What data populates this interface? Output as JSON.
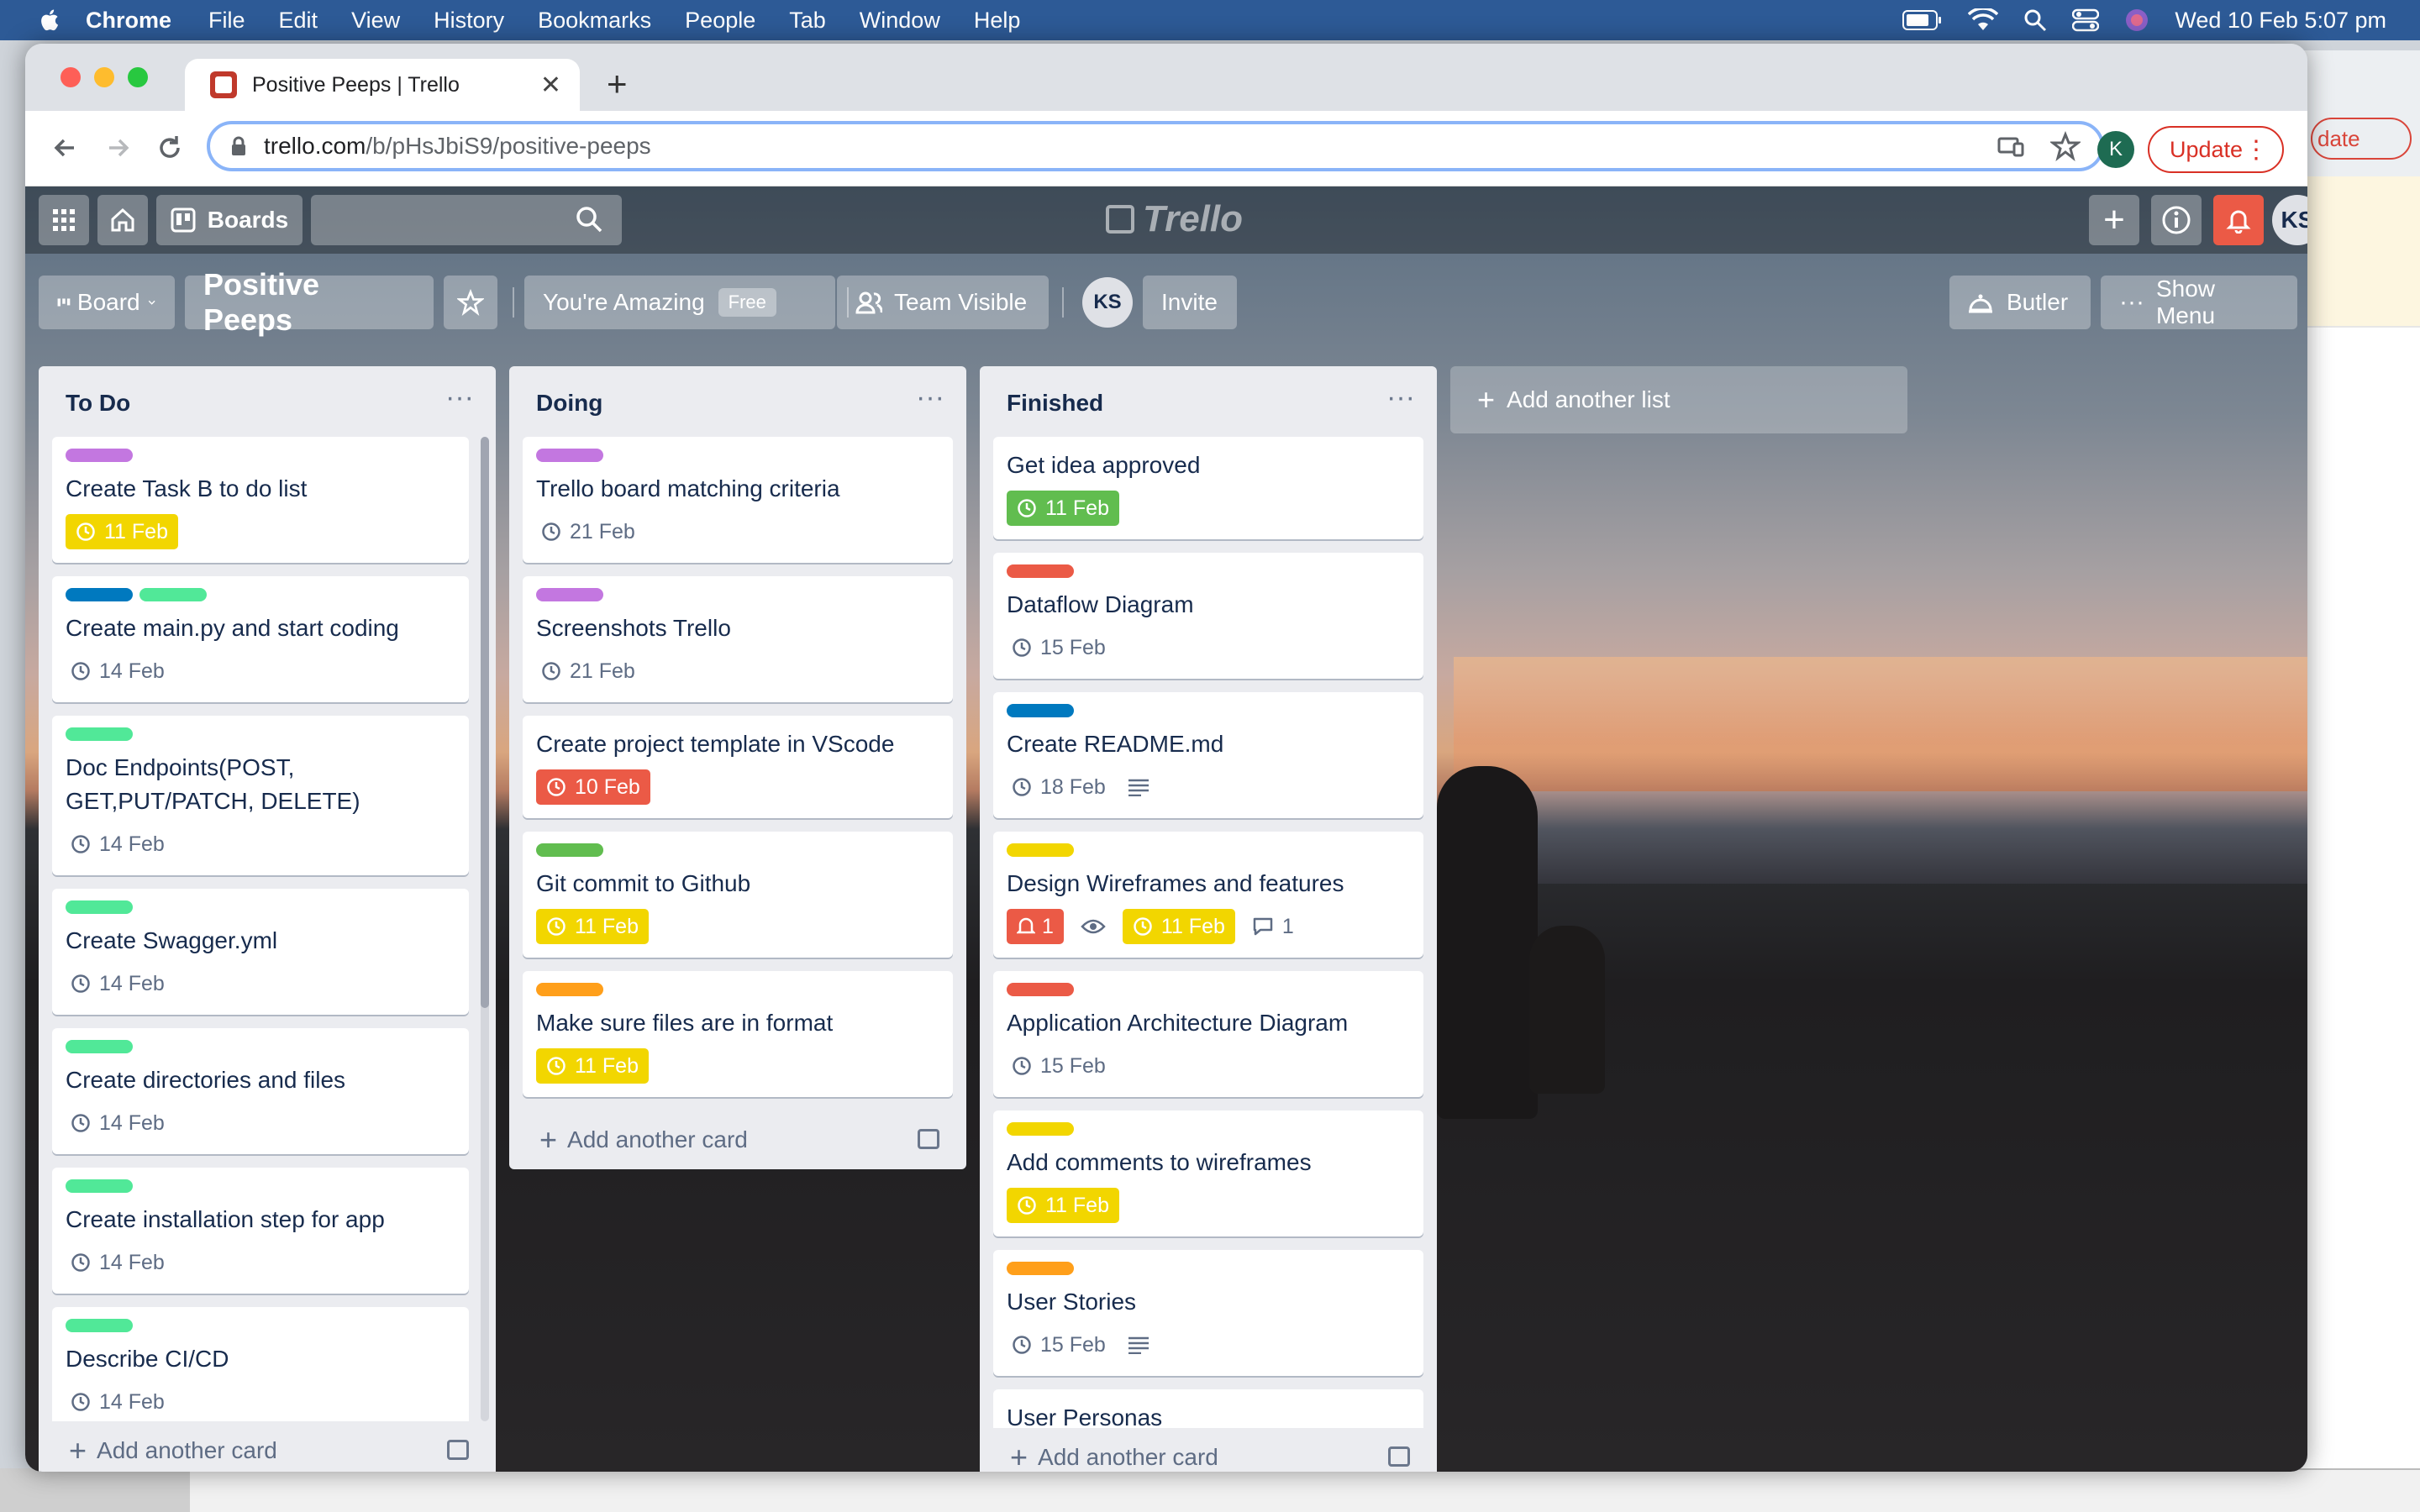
{
  "menubar": {
    "app": "Chrome",
    "items": [
      "File",
      "Edit",
      "View",
      "History",
      "Bookmarks",
      "People",
      "Tab",
      "Window",
      "Help"
    ],
    "datetime": "Wed 10 Feb  5:07 pm"
  },
  "browser": {
    "tab_title": "Positive Peeps | Trello",
    "url_host": "trello.com",
    "url_path": "/b/pHsJbiS9/positive-peeps",
    "profile_initial": "K",
    "update_label": "Update",
    "bg_update_fragment": "date"
  },
  "trello_nav": {
    "boards_label": "Boards",
    "logo_text": "Trello",
    "avatar_initials": "KS"
  },
  "board_header": {
    "view_label": "Board",
    "board_title": "Positive Peeps",
    "team_name": "You're Amazing",
    "team_badge": "Free",
    "visibility_label": "Team Visible",
    "member_initials": "KS",
    "invite_label": "Invite",
    "butler_label": "Butler",
    "show_menu_label": "Show Menu"
  },
  "lists": {
    "todo": {
      "title": "To Do",
      "add_card": "Add another card",
      "cards": [
        {
          "title": "Create Task B to do list",
          "due": "11 Feb"
        },
        {
          "title": "Create main.py and start coding",
          "due": "14 Feb"
        },
        {
          "title": "Doc Endpoints(POST, GET,PUT/PATCH, DELETE)",
          "due": "14 Feb"
        },
        {
          "title": "Create Swagger.yml",
          "due": "14 Feb"
        },
        {
          "title": "Create directories and files",
          "due": "14 Feb"
        },
        {
          "title": "Create installation step for app",
          "due": "14 Feb"
        },
        {
          "title": "Describe CI/CD",
          "due": "14 Feb"
        }
      ]
    },
    "doing": {
      "title": "Doing",
      "add_card": "Add another card",
      "cards": [
        {
          "title": "Trello board matching criteria",
          "due": "21 Feb"
        },
        {
          "title": "Screenshots Trello",
          "due": "21 Feb"
        },
        {
          "title": "Create project template in VScode",
          "due": "10 Feb"
        },
        {
          "title": "Git commit to Github",
          "due": "11 Feb"
        },
        {
          "title": "Make sure files are in format",
          "due": "11 Feb"
        }
      ]
    },
    "finished": {
      "title": "Finished",
      "add_card": "Add another card",
      "cards": [
        {
          "title": "Get idea approved",
          "due": "11 Feb"
        },
        {
          "title": "Dataflow Diagram",
          "due": "15 Feb"
        },
        {
          "title": "Create README.md",
          "due": "18 Feb"
        },
        {
          "title": "Design Wireframes and features",
          "due": "11 Feb",
          "notifications": "1",
          "comments": "1"
        },
        {
          "title": "Application Architecture Diagram",
          "due": "15 Feb"
        },
        {
          "title": "Add comments to wireframes",
          "due": "11 Feb"
        },
        {
          "title": "User Stories",
          "due": "15 Feb"
        },
        {
          "title": "User Personas"
        }
      ]
    },
    "add_list": "Add another list"
  },
  "colors": {
    "label_purple": "#c377e0",
    "label_blue": "#0079bf",
    "label_green": "#51e898",
    "label_green_dark": "#61bd4f",
    "label_red": "#eb5a46",
    "label_orange": "#ff9f1a",
    "label_yellow": "#f2d600",
    "notification_red": "#eb5a46"
  }
}
